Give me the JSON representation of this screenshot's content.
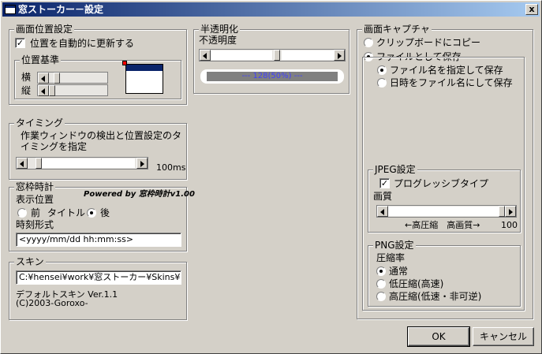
{
  "window": {
    "title": "窓ストーカー－設定",
    "close_label": "x"
  },
  "position_group": {
    "legend": "画面位置設定",
    "auto_update_label": "位置を自動的に更新する",
    "auto_update_checked": true,
    "ref_legend": "位置基準",
    "horizontal_label": "横",
    "vertical_label": "縦"
  },
  "timing_group": {
    "legend": "タイミング",
    "description_line1": "作業ウィンドウの検出と位置設定のタ",
    "description_line2": "イミングを指定",
    "value_label": "100ms"
  },
  "clock_group": {
    "legend": "窓枠時計",
    "powered_by": "Powered by 窓枠時計v1.00",
    "display_position_label": "表示位置",
    "front_label": "前",
    "title_label": "タイトル",
    "back_label": "後",
    "selected": "back",
    "format_label": "時刻形式",
    "format_value": "<yyyy/mm/dd hh:mm:ss>"
  },
  "skin_group": {
    "legend": "スキン",
    "path_value": "C:¥hensei¥work¥窓ストーカー¥Skins¥De",
    "skin_name": "デフォルトスキン Ver.1.1",
    "copyright": "(C)2003-Goroxo-"
  },
  "opacity_group": {
    "legend": "半透明化",
    "opacity_label": "不透明度",
    "readout": "--- 128(50%) ---",
    "level": 0.5
  },
  "capture_group": {
    "legend": "画面キャプチャ",
    "clipboard_label": "クリップボードにコピー",
    "save_file_label": "ファイルとして保存",
    "specify_name_label": "ファイル名を指定して保存",
    "datetime_name_label": "日時をファイル名にして保存",
    "jpeg_legend": "JPEG設定",
    "progressive_label": "プログレッシブタイプ",
    "progressive_checked": true,
    "quality_label": "画質",
    "quality_scale_label": "←高圧縮　高画質→",
    "quality_value": "100",
    "png_legend": "PNG設定",
    "compression_label": "圧縮率",
    "normal_label": "通常",
    "low_label": "低圧縮(高速)",
    "high_label": "高圧縮(低速・非可逆)"
  },
  "buttons": {
    "ok_label": "OK",
    "cancel_label": "キャンセル"
  }
}
